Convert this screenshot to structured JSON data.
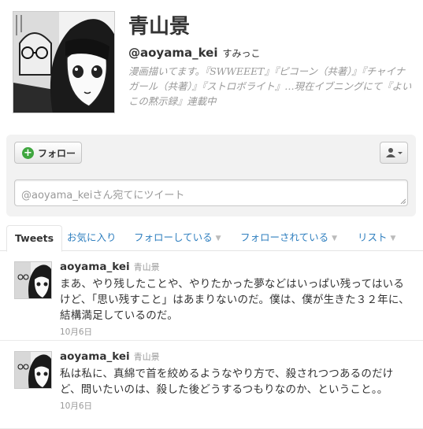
{
  "profile": {
    "full_name": "青山景",
    "screen_name": "@aoyama_kei",
    "location": "すみっこ",
    "bio": "漫画描いてます。『SWWEEET』『ピコーン（共著）』『チャイナガール（共著）』『ストロボライト』…現在イブニングにて『よいこの黙示録』連載中"
  },
  "actions": {
    "follow_label": "フォロー",
    "tweet_box_placeholder": "@aoyama_keiさん宛てにツイート"
  },
  "tabs": [
    {
      "label": "Tweets"
    },
    {
      "label": "お気に入り"
    },
    {
      "label": "フォローしている"
    },
    {
      "label": "フォローされている"
    },
    {
      "label": "リスト"
    }
  ],
  "tweets": [
    {
      "user": "aoyama_kei",
      "full_name": "青山景",
      "text": "まあ、やり残したことや、やりたかった夢などはいっぱい残ってはいるけど、「思い残すこと」はあまりないのだ。僕は、僕が生きた３２年に、結構満足しているのだ。",
      "time": "10月6日"
    },
    {
      "user": "aoyama_kei",
      "full_name": "青山景",
      "text": "私は私に、真綿で首を絞めるようなやり方で、殺されつつあるのだけど、問いたいのは、殺した後どうするつもりなのか、ということ。。",
      "time": "10月6日"
    }
  ],
  "colors": {
    "link": "#2f7fbf",
    "follow_plus": "#3fa63f",
    "muted": "#999999"
  }
}
